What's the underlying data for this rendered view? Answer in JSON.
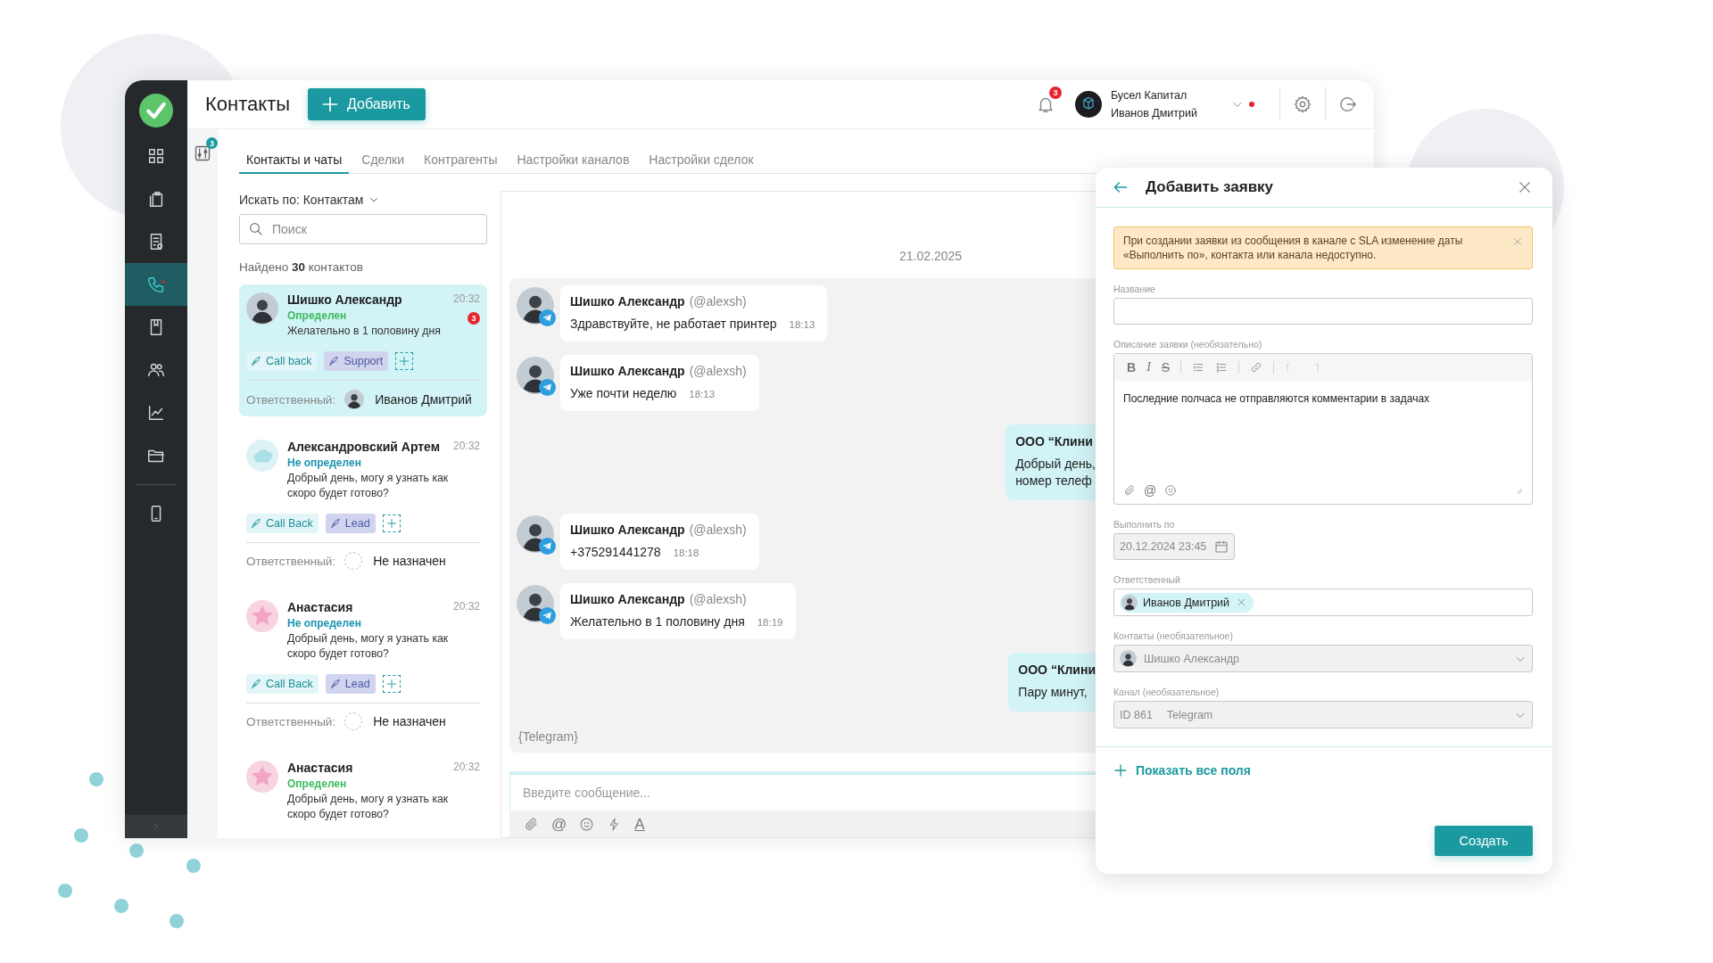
{
  "sidebar": {
    "items": [
      {
        "selected": false
      },
      {
        "selected": false
      },
      {
        "selected": false
      },
      {
        "selected": true
      },
      {
        "selected": false
      },
      {
        "selected": false
      },
      {
        "selected": false
      },
      {
        "selected": false
      }
    ],
    "extra_items": [
      {
        "selected": false
      }
    ]
  },
  "header": {
    "title": "Контакты",
    "add_button": "Добавить",
    "notifications": "3",
    "company": "Бусел Капитал",
    "user": "Иванов Дмитрий"
  },
  "filter_badge": "3",
  "tabs": [
    {
      "label": "Контакты и чаты",
      "selected": true
    },
    {
      "label": "Сделки",
      "selected": false
    },
    {
      "label": "Контрагенты",
      "selected": false
    },
    {
      "label": "Настройки каналов",
      "selected": false
    },
    {
      "label": "Настройки сделок",
      "selected": false
    }
  ],
  "search": {
    "scope": "Искать по: Контактам",
    "placeholder": "Поиск"
  },
  "found": "Найдено **30** контактов",
  "contacts": [
    {
      "name": "Шишко Александр",
      "time": "20:32",
      "status": "Определен",
      "identified": true,
      "preview": "Желательно в 1 половину дня",
      "unread": "3",
      "avatar": {
        "kind": "photo"
      },
      "tags": [
        {
          "label": "Call back",
          "kind": "action"
        },
        {
          "label": "Support",
          "kind": "category"
        }
      ],
      "responsible_label": "Ответственный:",
      "responsible": "Иванов Дмитрий",
      "assigned": true,
      "selected": true
    },
    {
      "name": "Александровский Артем",
      "time": "20:32",
      "status": "Не определен",
      "identified": false,
      "preview": "Добрый день, могу я узнать как скоро будет готово?",
      "avatar": {
        "kind": "cloud"
      },
      "tags": [
        {
          "label": "Call Back",
          "kind": "action"
        },
        {
          "label": "Lead",
          "kind": "category"
        }
      ],
      "responsible_label": "Ответственный:",
      "responsible": "Не назначен",
      "assigned": false,
      "selected": false
    },
    {
      "name": "Анастасия",
      "time": "20:32",
      "status": "Не определен",
      "identified": false,
      "preview": "Добрый день, могу я узнать как скоро будет готово?",
      "avatar": {
        "kind": "star"
      },
      "tags": [
        {
          "label": "Call Back",
          "kind": "action"
        },
        {
          "label": "Lead",
          "kind": "category"
        }
      ],
      "responsible_label": "Ответственный:",
      "responsible": "Не назначен",
      "assigned": false,
      "selected": false
    },
    {
      "name": "Анастасия",
      "time": "20:32",
      "status": "Определен",
      "identified": true,
      "preview": "Добрый день, могу я узнать как скоро будет готово?",
      "avatar": {
        "kind": "star"
      },
      "selected": false
    }
  ],
  "chat": {
    "date": "21.02.2025",
    "messages": [
      {
        "kind": "incoming",
        "author": "Шишко Александр",
        "handle": "(@alexsh)",
        "text": "Здравствуйте, не работает принтер",
        "time": "18:13"
      },
      {
        "kind": "incoming",
        "author": "Шишко Александр",
        "handle": "(@alexsh)",
        "text": "Уже почти неделю",
        "time": "18:13"
      },
      {
        "kind": "outgoing",
        "author": "ООО “Клини",
        "lines": [
          "Добрый день,",
          "номер телеф"
        ]
      },
      {
        "kind": "incoming",
        "author": "Шишко Александр",
        "handle": "(@alexsh)",
        "text": "+375291441278",
        "time": "18:18"
      },
      {
        "kind": "incoming",
        "author": "Шишко Александр",
        "handle": "(@alexsh)",
        "text": "Желательно в 1 половину дня",
        "time": "18:19"
      },
      {
        "kind": "outgoing",
        "author": "ООО “Клини",
        "lines": [
          "Пару минут,"
        ]
      }
    ],
    "channel": "{Telegram}",
    "composer_placeholder": "Введите сообщение...",
    "composer_tools": [
      {
        "kind": "attach"
      },
      {
        "kind": "mention",
        "label": "@"
      },
      {
        "kind": "emoji"
      },
      {
        "kind": "lightning"
      },
      {
        "kind": "text_color",
        "label": "A"
      }
    ]
  },
  "request_form": {
    "title": "Добавить заявку",
    "alert": "При создании заявки из сообщения в канале с SLA изменение даты «Выполнить по», контакта или канала недоступно.",
    "fields": [
      {
        "kind": "text",
        "label": "Название"
      },
      {
        "kind": "editor",
        "label": "Описание заявки (необязательно)",
        "value": "Последние полчаса не отправляются комментарии в задачах",
        "tools": [
          {
            "kind": "bold",
            "label": "B",
            "disabled": false
          },
          {
            "kind": "italic",
            "label": "I",
            "disabled": false
          },
          {
            "kind": "strike",
            "label": "S",
            "disabled": false
          },
          {
            "kind": "bullets",
            "disabled": false
          },
          {
            "kind": "numbers",
            "disabled": false
          },
          {
            "kind": "link",
            "disabled": false
          },
          {
            "kind": "undo",
            "disabled": true
          },
          {
            "kind": "redo",
            "disabled": true
          }
        ],
        "attachments": [
          {
            "kind": "attach"
          },
          {
            "kind": "mention",
            "label": "@"
          },
          {
            "kind": "emoji"
          }
        ]
      },
      {
        "kind": "date",
        "label": "Выполнить по",
        "value": "20.12.2024 23:45",
        "disabled": true
      },
      {
        "kind": "chips",
        "label": "Ответственный",
        "value": "Иванов Дмитрий",
        "disabled": false
      },
      {
        "kind": "select",
        "label": "Контакты (необязательное)",
        "value": "Шишко Александр",
        "avatar": true,
        "disabled": true
      },
      {
        "kind": "select",
        "label": "Канал (необязательное)",
        "value": "ID 861",
        "detail": "Telegram",
        "disabled": true
      }
    ],
    "show_all": "Показать все поля",
    "submit": "Создать"
  }
}
